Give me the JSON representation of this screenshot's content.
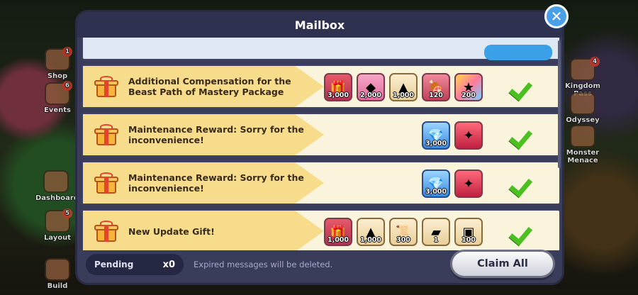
{
  "modal": {
    "title": "Mailbox",
    "close_icon": "close-icon"
  },
  "side_left": [
    {
      "label": "Shop",
      "badge": "1"
    },
    {
      "label": "Events",
      "badge": "6"
    },
    {
      "label": "Dashboard",
      "badge": ""
    },
    {
      "label": "Layout",
      "badge": "5"
    },
    {
      "label": "Build",
      "badge": ""
    }
  ],
  "side_right": [
    {
      "label": "Kingdom Pass",
      "badge": "4"
    },
    {
      "label": "Odyssey",
      "badge": ""
    },
    {
      "label": "Monster Menace",
      "badge": ""
    }
  ],
  "messages": [
    {
      "title": "Additional Compensation for the Beast Path of Mastery Package",
      "items": [
        {
          "icon": "gift-box-icon",
          "qty": "3,000",
          "style": "it-red"
        },
        {
          "icon": "cube-icon",
          "qty": "2,000",
          "style": "it-pink"
        },
        {
          "icon": "rune-stone-icon",
          "qty": "1,000",
          "style": "it-cream"
        },
        {
          "icon": "meat-icon",
          "qty": "120",
          "style": "it-rose"
        },
        {
          "icon": "star-jelly-icon",
          "qty": "200",
          "style": "it-multi"
        }
      ]
    },
    {
      "title": "Maintenance Reward: Sorry for the inconvenience!",
      "items": [
        {
          "icon": "crystal-icon",
          "qty": "3,000",
          "style": "it-blue"
        },
        {
          "icon": "cookie-cutter-icon",
          "qty": "",
          "style": "it-crimson"
        }
      ]
    },
    {
      "title": "Maintenance Reward: Sorry for the inconvenience!",
      "items": [
        {
          "icon": "crystal-icon",
          "qty": "3,000",
          "style": "it-blue"
        },
        {
          "icon": "cookie-cutter-icon",
          "qty": "",
          "style": "it-crimson"
        }
      ]
    },
    {
      "title": "New Update Gift!",
      "items": [
        {
          "icon": "gift-box-icon",
          "qty": "1,000",
          "style": "it-red"
        },
        {
          "icon": "rune-stone-icon",
          "qty": "1,000",
          "style": "it-cream"
        },
        {
          "icon": "scroll-icon",
          "qty": "300",
          "style": "it-cream"
        },
        {
          "icon": "treasure-chest-icon",
          "qty": "1",
          "style": "it-cream"
        },
        {
          "icon": "ticket-icon",
          "qty": "100",
          "style": "it-cream"
        }
      ]
    }
  ],
  "footer": {
    "pending_label": "Pending",
    "pending_count": "x0",
    "expire_note": "Expired messages will be deleted.",
    "claim_all_label": "Claim All"
  }
}
